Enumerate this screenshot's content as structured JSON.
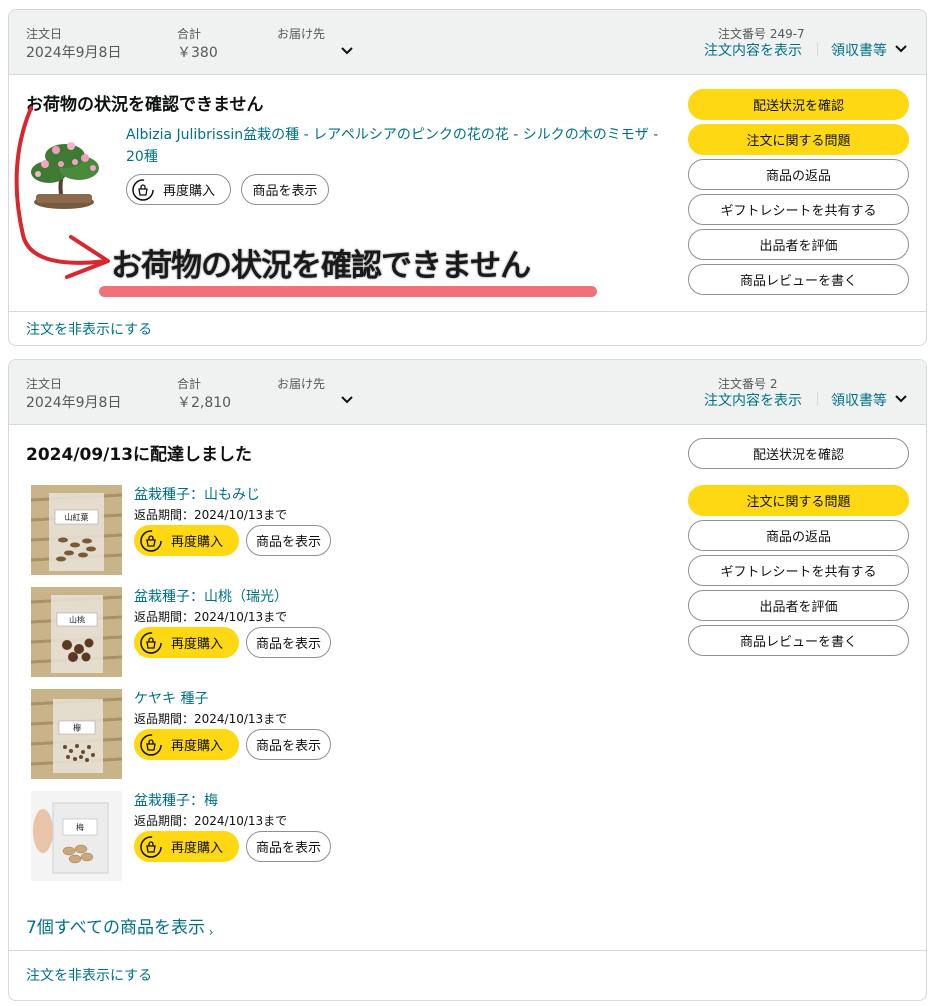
{
  "orders": [
    {
      "header": {
        "order_date_label": "注文日",
        "order_date": "2024年9月8日",
        "total_label": "合計",
        "total": "￥380",
        "ship_to_label": "お届け先",
        "order_number_label": "注文番号 249-7",
        "details_link": "注文内容を表示",
        "receipt_link": "領収書等"
      },
      "status": "お荷物の状況を確認できません",
      "annotation": "お荷物の状況を確認できません",
      "item": {
        "title": "Albizia Julibrissin盆栽の種 - レアペルシアのピンクの花の花 - シルクの木のミモザ - 20種",
        "rebuy_label": "再度購入",
        "view_label": "商品を表示"
      },
      "actions": [
        "配送状況を確認",
        "注文に関する問題",
        "商品の返品",
        "ギフトレシートを共有する",
        "出品者を評価",
        "商品レビューを書く"
      ],
      "hide_link": "注文を非表示にする"
    },
    {
      "header": {
        "order_date_label": "注文日",
        "order_date": "2024年9月8日",
        "total_label": "合計",
        "total": "￥2,810",
        "ship_to_label": "お届け先",
        "order_number_label": "注文番号 2",
        "details_link": "注文内容を表示",
        "receipt_link": "領収書等"
      },
      "status": "2024/09/13に配達しました",
      "items": [
        {
          "title": "盆栽種子：山もみじ",
          "return": "返品期間：2024/10/13まで",
          "rebuy_label": "再度購入",
          "view_label": "商品を表示",
          "tag": "山紅葉"
        },
        {
          "title": "盆栽種子：山桃（瑞光）",
          "return": "返品期間：2024/10/13まで",
          "rebuy_label": "再度購入",
          "view_label": "商品を表示",
          "tag": "山桃"
        },
        {
          "title": "ケヤキ 種子",
          "return": "返品期間：2024/10/13まで",
          "rebuy_label": "再度購入",
          "view_label": "商品を表示",
          "tag": "欅"
        },
        {
          "title": "盆栽種子：梅",
          "return": "返品期間：2024/10/13まで",
          "rebuy_label": "再度購入",
          "view_label": "商品を表示",
          "tag": "梅"
        }
      ],
      "actions": [
        "配送状況を確認",
        "注文に関する問題",
        "商品の返品",
        "ギフトレシートを共有する",
        "出品者を評価",
        "商品レビューを書く"
      ],
      "show_all_link": "7個すべての商品を表示",
      "hide_link": "注文を非表示にする"
    }
  ],
  "colors": {
    "link": "#007185",
    "button_yellow": "#ffd814",
    "header_bg": "#f0f2f2",
    "annotation_arrow": "#d9262f",
    "annotation_underline": "#f07178"
  },
  "icons": {
    "chevron": "chevron-down-icon",
    "rebuy": "rebuy-icon",
    "arrow": "annotation-arrow-icon"
  }
}
